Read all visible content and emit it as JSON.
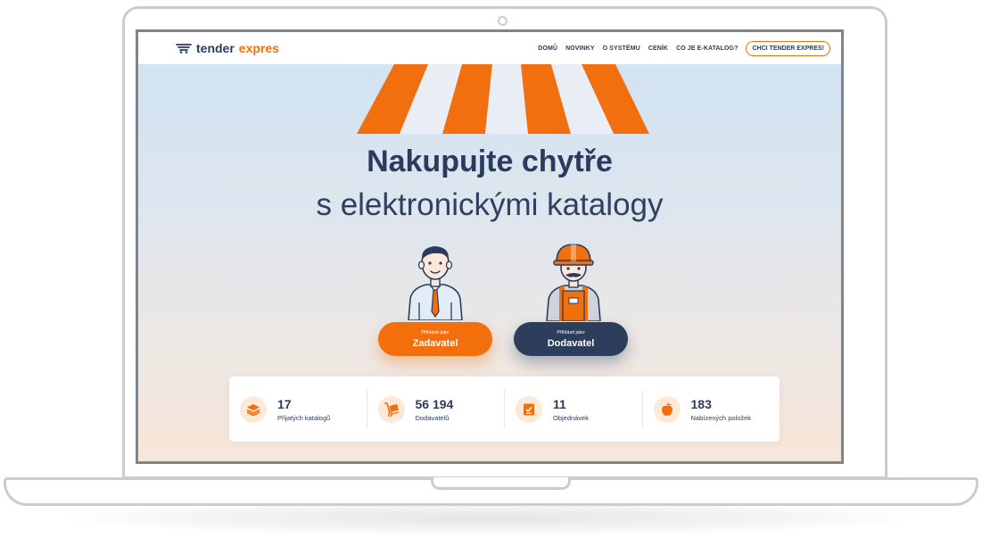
{
  "nav": {
    "logo_part1": "tender",
    "logo_part2": "expres",
    "items": [
      "DOMŮ",
      "NOVINKY",
      "O SYSTÉMU",
      "CENÍK",
      "CO JE E-KATALOG?"
    ],
    "cta": "CHCI TENDER EXPRES!"
  },
  "hero": {
    "title": "Nakupujte chytře",
    "subtitle": "s elektronickými katalogy"
  },
  "login": {
    "client": {
      "small": "Přihlásit jako",
      "label": "Zadavatel"
    },
    "supplier": {
      "small": "Přihlásit jako",
      "label": "Dodavatel"
    }
  },
  "stats": [
    {
      "value": "17",
      "label": "Přijatých katalogů",
      "icon": "layers-icon"
    },
    {
      "value": "56 194",
      "label": "Dodavatelů",
      "icon": "hand-truck-icon"
    },
    {
      "value": "11",
      "label": "Objednávek",
      "icon": "checklist-icon"
    },
    {
      "value": "183",
      "label": "Nabízených položek",
      "icon": "apple-icon"
    }
  ],
  "colors": {
    "accent": "#f36f0c",
    "navy": "#2a3c5e",
    "navy_button": "#2c3e5c"
  }
}
